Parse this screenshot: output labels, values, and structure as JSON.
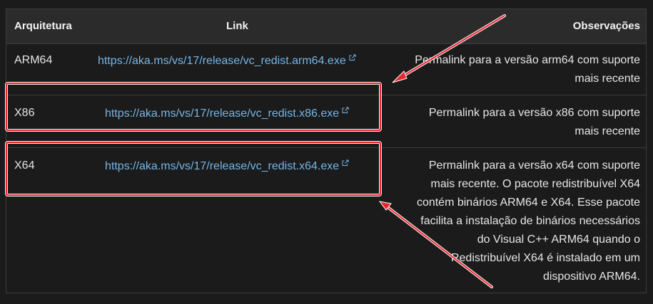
{
  "table": {
    "headers": {
      "arch": "Arquitetura",
      "link": "Link",
      "notes": "Observações"
    },
    "rows": [
      {
        "arch": "ARM64",
        "link": "https://aka.ms/vs/17/release/vc_redist.arm64.exe",
        "notes_lines": [
          "Permalink para a versão arm64 com suporte",
          "mais recente"
        ]
      },
      {
        "arch": "X86",
        "link": "https://aka.ms/vs/17/release/vc_redist.x86.exe",
        "notes_lines": [
          "Permalink para a versão x86 com suporte",
          "mais recente"
        ]
      },
      {
        "arch": "X64",
        "link": "https://aka.ms/vs/17/release/vc_redist.x64.exe",
        "notes_lines": [
          "Permalink para a versão x64 com suporte",
          "mais recente. O pacote redistribuível X64",
          "contém binários ARM64 e X64. Esse pacote",
          "facilita a instalação de binários necessários",
          "do Visual C++ ARM64 quando o",
          "Redistribuível X64 é instalado em um",
          "dispositivo ARM64."
        ]
      }
    ],
    "external_link_icon": "external-link-icon"
  },
  "annotations": {
    "highlight_color": "#e8262f",
    "highlighted_rows": [
      "X86",
      "X64"
    ],
    "arrow_color": "#e8262f"
  },
  "colors": {
    "background": "#1b1b1b",
    "header_background": "#2b2b2b",
    "link": "#75b6e7",
    "text": "#e6e6e6"
  }
}
